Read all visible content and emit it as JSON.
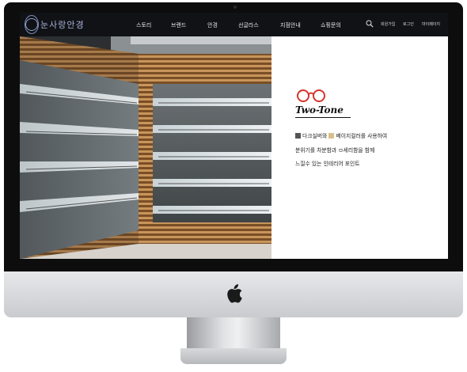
{
  "header": {
    "logo_text": "눈사랑안경",
    "nav": [
      {
        "label": "스토리"
      },
      {
        "label": "브랜드"
      },
      {
        "label": "안경"
      },
      {
        "label": "선글라스"
      },
      {
        "label": "지점안내"
      },
      {
        "label": "쇼핑문의"
      }
    ],
    "util": [
      {
        "label": "회원가입"
      },
      {
        "label": "로그인"
      },
      {
        "label": "마이페이지"
      }
    ],
    "search_icon": "search-icon"
  },
  "hero": {
    "photo_alt": "optical shop interior with wood slat walls and glass display shelves",
    "brand_title": "Two-Tone",
    "line1_a": "다크실버와",
    "line1_b": "베이지컬러를 사용하여",
    "line2": "분위기를 차분함과 ㅁ세리함을 함께",
    "line3": "느낄수 있는 인테리어 포인트",
    "swatch_dark_color": "#555555",
    "swatch_beige_color": "#d9c08a",
    "accent_color": "#d5352a"
  },
  "device": {
    "icon": "apple-logo-icon"
  }
}
